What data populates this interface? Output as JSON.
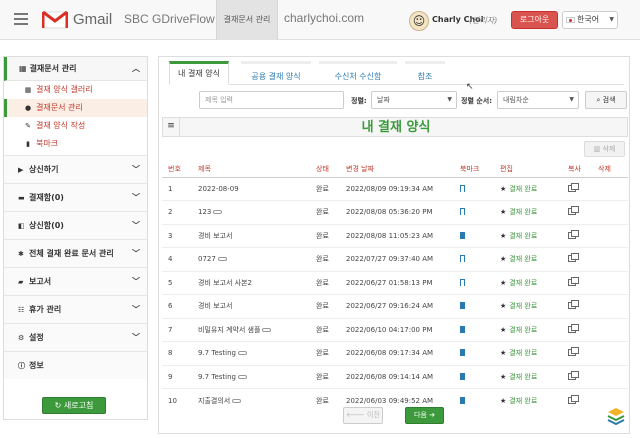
{
  "header": {
    "gmail_word": "Gmail",
    "app_name": "SBC GDriveFlow",
    "nav_tab": "결재문서 관리",
    "domain": "charlychoi.com",
    "user_name": "Charly Choi",
    "user_role": "(관리자)",
    "logout": "로그아웃",
    "language": "한국어"
  },
  "sidebar": {
    "main_section": "결재문서 관리",
    "sub_items": [
      {
        "label": "결재 양식 갤러리",
        "icon": "grid-icon"
      },
      {
        "label": "결재문서 관리",
        "icon": "dot-icon"
      },
      {
        "label": "결재 양식 작성",
        "icon": "wrench-icon"
      },
      {
        "label": "북마크",
        "icon": "bookmark-icon"
      }
    ],
    "sections": [
      {
        "label": "상신하기",
        "icon": "play-icon"
      },
      {
        "label": "결재함(0)",
        "icon": "inbox-icon"
      },
      {
        "label": "상신함(0)",
        "icon": "outbox-icon"
      },
      {
        "label": "전체 결재 완료 문서 관리",
        "icon": "gear-icon"
      },
      {
        "label": "보고서",
        "icon": "briefcase-icon"
      },
      {
        "label": "휴가 관리",
        "icon": "users-icon"
      },
      {
        "label": "설정",
        "icon": "settings-icon"
      },
      {
        "label": "정보",
        "icon": "info-icon"
      }
    ],
    "refresh": "새로고침"
  },
  "main": {
    "tabs": [
      "내 결재 양식",
      "공용 결재 양식",
      "수신처 수신함",
      "참조"
    ],
    "search": {
      "placeholder": "제목 입력",
      "sort_label": "정렬:",
      "sort_value": "날짜",
      "order_label": "정렬 순서:",
      "order_value": "내림차순",
      "button": "검색"
    },
    "title": "내 결재 양식",
    "delete_button": "삭제",
    "columns": [
      "번호",
      "제목",
      "상태",
      "변경 날짜",
      "북마크",
      "편집",
      "복사",
      "삭제"
    ],
    "rows": [
      {
        "no": "1",
        "title": "2022-08-09",
        "attach": false,
        "status": "완료",
        "date": "2022/08/09 09:19:34 AM",
        "bookmarked": false,
        "edit": "결재 완료"
      },
      {
        "no": "2",
        "title": "123",
        "attach": true,
        "status": "완료",
        "date": "2022/08/08 05:36:20 PM",
        "bookmarked": false,
        "edit": "결재 완료"
      },
      {
        "no": "3",
        "title": "경비 보고서",
        "attach": false,
        "status": "완료",
        "date": "2022/08/08 11:05:23 AM",
        "bookmarked": true,
        "edit": "결재 완료"
      },
      {
        "no": "4",
        "title": "0727",
        "attach": true,
        "status": "완료",
        "date": "2022/07/27 09:37:40 AM",
        "bookmarked": false,
        "edit": "결재 완료"
      },
      {
        "no": "5",
        "title": "경비 보고서 사본2",
        "attach": false,
        "status": "완료",
        "date": "2022/06/27 01:58:13 PM",
        "bookmarked": false,
        "edit": "결재 완료"
      },
      {
        "no": "6",
        "title": "경비 보고서",
        "attach": false,
        "status": "완료",
        "date": "2022/06/27 09:16:24 AM",
        "bookmarked": true,
        "edit": "결재 완료"
      },
      {
        "no": "7",
        "title": "비밀유지 계약서 샘플",
        "attach": true,
        "status": "완료",
        "date": "2022/06/10 04:17:00 PM",
        "bookmarked": true,
        "edit": "결재 완료"
      },
      {
        "no": "8",
        "title": "9.7 Testing",
        "attach": true,
        "status": "완료",
        "date": "2022/06/08 09:17:34 AM",
        "bookmarked": true,
        "edit": "결재 완료"
      },
      {
        "no": "9",
        "title": "9.7 Testing",
        "attach": true,
        "status": "완료",
        "date": "2022/06/08 09:14:14 AM",
        "bookmarked": true,
        "edit": "결재 완료"
      },
      {
        "no": "10",
        "title": "지출결의서",
        "attach": true,
        "status": "완료",
        "date": "2022/06/03 09:49:52 AM",
        "bookmarked": true,
        "edit": "결재 완료"
      }
    ],
    "prev": "이전",
    "next": "다음"
  },
  "colors": {
    "accent": "#3c9a3c",
    "danger": "#d9534f",
    "link": "#2a7ab0"
  }
}
